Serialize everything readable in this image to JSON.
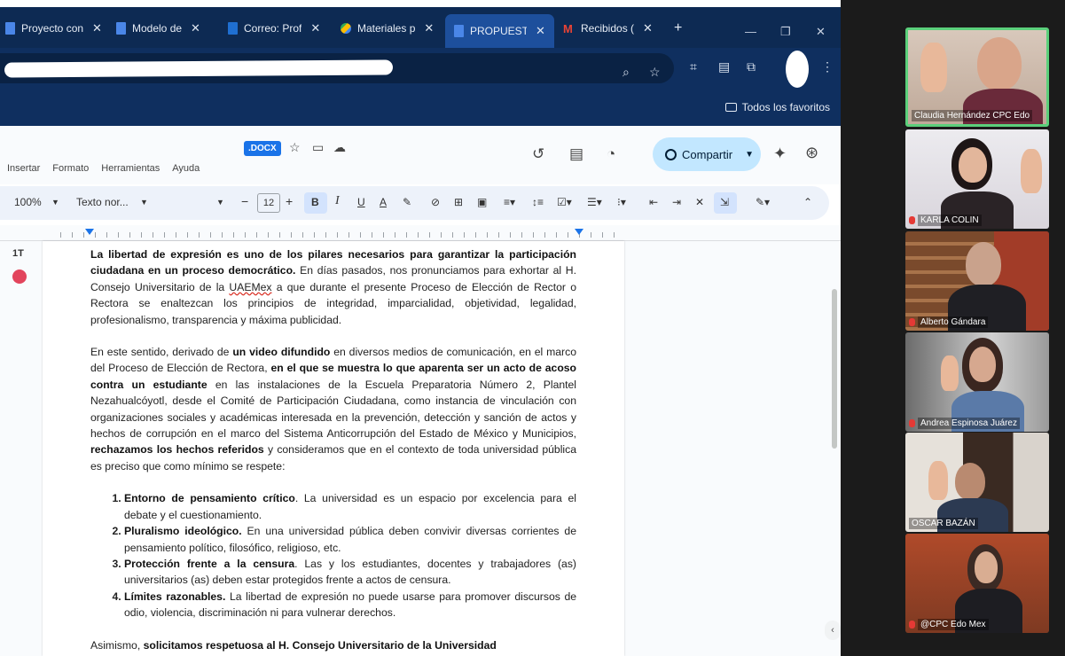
{
  "tabs": [
    {
      "label": "Proyecto con",
      "icon": "docs-icon"
    },
    {
      "label": "Modelo de",
      "icon": "docs-icon"
    },
    {
      "label": "Correo: Prof",
      "icon": "outlook-icon"
    },
    {
      "label": "Materiales p",
      "icon": "drive-icon"
    },
    {
      "label": "PROPUESTA",
      "icon": "docs-icon"
    },
    {
      "label": "Recibidos (",
      "icon": "gmail-icon"
    }
  ],
  "tab_new": "+",
  "tab_close": "✕",
  "window_controls": {
    "minimize": "—",
    "maximize": "❐",
    "close": "✕"
  },
  "bookmarks": {
    "all_favorites": "Todos los favoritos"
  },
  "docs": {
    "docx_badge": ".DOCX",
    "menus": [
      "Insertar",
      "Formato",
      "Herramientas",
      "Ayuda"
    ],
    "share_label": "Compartir",
    "toolbar": {
      "zoom": "100%",
      "style": "Texto nor...",
      "font_size": "12",
      "minus": "−",
      "plus": "+",
      "bold": "B",
      "italic": "I",
      "underline": "U",
      "text_color": "A"
    },
    "side_tool": "1T",
    "paragraphs": {
      "p1_bold": "La libertad de expresión es uno de los pilares necesarios para garantizar la participación ciudadana en un proceso democrático.",
      "p1_a": " En días pasados, nos pronunciamos para exhortar al H. Consejo Universitario de la ",
      "p1_uaemex": "UAEMex",
      "p1_b": " a que durante el presente Proceso de Elección de Rector o Rectora se enaltezcan los principios de integridad, imparcialidad, objetividad, legalidad, profesionalismo, transparencia y máxima publicidad.",
      "p2_a": "En este sentido, derivado de ",
      "p2_b1": "un video difundido",
      "p2_c": " en diversos medios de comunicación, en el marco del Proceso de Elección de Rectora, ",
      "p2_b2": "en el que se muestra lo que aparenta ser un acto de acoso contra un estudiante",
      "p2_d": " en las instalaciones de la Escuela Preparatoria Número 2, Plantel Nezahualcóyotl, desde el Comité de Participación Ciudadana, como instancia de vinculación con organizaciones sociales y académicas interesada en la prevención, detección y sanción de actos y hechos de corrupción en el marco del Sistema Anticorrupción del Estado de México y Municipios, ",
      "p2_b3": "rechazamos los hechos referidos",
      "p2_e": " y consideramos  que en el contexto de toda universidad pública es preciso que como mínimo se respete:",
      "p3_a": "Asimismo, ",
      "p3_b": "solicitamos respetuosa al H. Consejo Universitario de la Universidad"
    },
    "list": [
      {
        "title": "Entorno de pensamiento crítico",
        "text": ". La universidad es un espacio por excelencia para el debate y el cuestionamiento."
      },
      {
        "title": "Pluralismo ideológico.",
        "text": " En una universidad pública deben convivir diversas corrientes de pensamiento político, filosófico, religioso, etc."
      },
      {
        "title": "Protección frente a la censura",
        "text": ". Las y los estudiantes, docentes y trabajadores (as) universitarios (as) deben estar protegidos frente a actos de censura."
      },
      {
        "title": "Límites razonables.",
        "text": " La libertad de expresión no puede usarse para promover discursos de odio, violencia, discriminación ni para vulnerar derechos."
      }
    ]
  },
  "participants": [
    {
      "name": "Claudia Hernández CPC Edo",
      "active": true
    },
    {
      "name": "KARLA COLIN",
      "active": false
    },
    {
      "name": "Alberto Gándara",
      "active": false
    },
    {
      "name": "Andrea Espinosa Juárez",
      "active": false
    },
    {
      "name": "OSCAR BAZÁN",
      "active": false
    },
    {
      "name": "@CPC Edo Mex",
      "active": false
    }
  ],
  "colors": {
    "tabbar": "#0d2a53",
    "share": "#c2e7ff",
    "active_speaker": "#5bd07b"
  }
}
